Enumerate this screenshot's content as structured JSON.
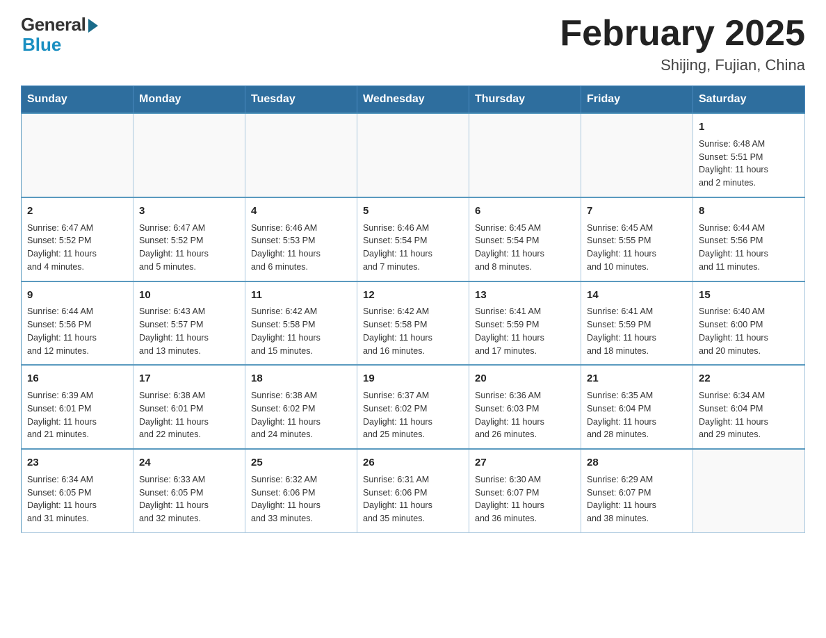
{
  "header": {
    "logo_general": "General",
    "logo_blue": "Blue",
    "month_title": "February 2025",
    "location": "Shijing, Fujian, China"
  },
  "weekdays": [
    "Sunday",
    "Monday",
    "Tuesday",
    "Wednesday",
    "Thursday",
    "Friday",
    "Saturday"
  ],
  "weeks": [
    [
      {
        "day": "",
        "info": ""
      },
      {
        "day": "",
        "info": ""
      },
      {
        "day": "",
        "info": ""
      },
      {
        "day": "",
        "info": ""
      },
      {
        "day": "",
        "info": ""
      },
      {
        "day": "",
        "info": ""
      },
      {
        "day": "1",
        "info": "Sunrise: 6:48 AM\nSunset: 5:51 PM\nDaylight: 11 hours\nand 2 minutes."
      }
    ],
    [
      {
        "day": "2",
        "info": "Sunrise: 6:47 AM\nSunset: 5:52 PM\nDaylight: 11 hours\nand 4 minutes."
      },
      {
        "day": "3",
        "info": "Sunrise: 6:47 AM\nSunset: 5:52 PM\nDaylight: 11 hours\nand 5 minutes."
      },
      {
        "day": "4",
        "info": "Sunrise: 6:46 AM\nSunset: 5:53 PM\nDaylight: 11 hours\nand 6 minutes."
      },
      {
        "day": "5",
        "info": "Sunrise: 6:46 AM\nSunset: 5:54 PM\nDaylight: 11 hours\nand 7 minutes."
      },
      {
        "day": "6",
        "info": "Sunrise: 6:45 AM\nSunset: 5:54 PM\nDaylight: 11 hours\nand 8 minutes."
      },
      {
        "day": "7",
        "info": "Sunrise: 6:45 AM\nSunset: 5:55 PM\nDaylight: 11 hours\nand 10 minutes."
      },
      {
        "day": "8",
        "info": "Sunrise: 6:44 AM\nSunset: 5:56 PM\nDaylight: 11 hours\nand 11 minutes."
      }
    ],
    [
      {
        "day": "9",
        "info": "Sunrise: 6:44 AM\nSunset: 5:56 PM\nDaylight: 11 hours\nand 12 minutes."
      },
      {
        "day": "10",
        "info": "Sunrise: 6:43 AM\nSunset: 5:57 PM\nDaylight: 11 hours\nand 13 minutes."
      },
      {
        "day": "11",
        "info": "Sunrise: 6:42 AM\nSunset: 5:58 PM\nDaylight: 11 hours\nand 15 minutes."
      },
      {
        "day": "12",
        "info": "Sunrise: 6:42 AM\nSunset: 5:58 PM\nDaylight: 11 hours\nand 16 minutes."
      },
      {
        "day": "13",
        "info": "Sunrise: 6:41 AM\nSunset: 5:59 PM\nDaylight: 11 hours\nand 17 minutes."
      },
      {
        "day": "14",
        "info": "Sunrise: 6:41 AM\nSunset: 5:59 PM\nDaylight: 11 hours\nand 18 minutes."
      },
      {
        "day": "15",
        "info": "Sunrise: 6:40 AM\nSunset: 6:00 PM\nDaylight: 11 hours\nand 20 minutes."
      }
    ],
    [
      {
        "day": "16",
        "info": "Sunrise: 6:39 AM\nSunset: 6:01 PM\nDaylight: 11 hours\nand 21 minutes."
      },
      {
        "day": "17",
        "info": "Sunrise: 6:38 AM\nSunset: 6:01 PM\nDaylight: 11 hours\nand 22 minutes."
      },
      {
        "day": "18",
        "info": "Sunrise: 6:38 AM\nSunset: 6:02 PM\nDaylight: 11 hours\nand 24 minutes."
      },
      {
        "day": "19",
        "info": "Sunrise: 6:37 AM\nSunset: 6:02 PM\nDaylight: 11 hours\nand 25 minutes."
      },
      {
        "day": "20",
        "info": "Sunrise: 6:36 AM\nSunset: 6:03 PM\nDaylight: 11 hours\nand 26 minutes."
      },
      {
        "day": "21",
        "info": "Sunrise: 6:35 AM\nSunset: 6:04 PM\nDaylight: 11 hours\nand 28 minutes."
      },
      {
        "day": "22",
        "info": "Sunrise: 6:34 AM\nSunset: 6:04 PM\nDaylight: 11 hours\nand 29 minutes."
      }
    ],
    [
      {
        "day": "23",
        "info": "Sunrise: 6:34 AM\nSunset: 6:05 PM\nDaylight: 11 hours\nand 31 minutes."
      },
      {
        "day": "24",
        "info": "Sunrise: 6:33 AM\nSunset: 6:05 PM\nDaylight: 11 hours\nand 32 minutes."
      },
      {
        "day": "25",
        "info": "Sunrise: 6:32 AM\nSunset: 6:06 PM\nDaylight: 11 hours\nand 33 minutes."
      },
      {
        "day": "26",
        "info": "Sunrise: 6:31 AM\nSunset: 6:06 PM\nDaylight: 11 hours\nand 35 minutes."
      },
      {
        "day": "27",
        "info": "Sunrise: 6:30 AM\nSunset: 6:07 PM\nDaylight: 11 hours\nand 36 minutes."
      },
      {
        "day": "28",
        "info": "Sunrise: 6:29 AM\nSunset: 6:07 PM\nDaylight: 11 hours\nand 38 minutes."
      },
      {
        "day": "",
        "info": ""
      }
    ]
  ]
}
